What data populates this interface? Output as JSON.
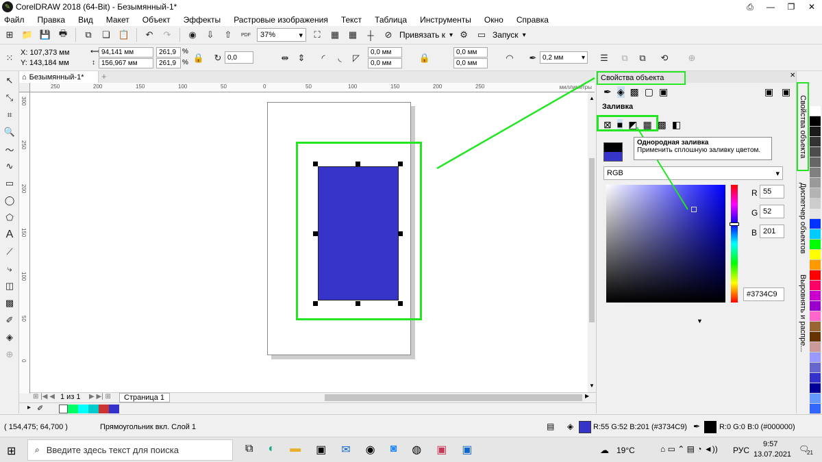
{
  "window": {
    "title": "CorelDRAW 2018 (64-Bit) - Безымянный-1*"
  },
  "menu": [
    "Файл",
    "Правка",
    "Вид",
    "Макет",
    "Объект",
    "Эффекты",
    "Растровые изображения",
    "Текст",
    "Таблица",
    "Инструменты",
    "Окно",
    "Справка"
  ],
  "toolbar": {
    "zoom": "37%",
    "snap_label": "Привязать к",
    "launch_label": "Запуск",
    "pdf_label": "PDF"
  },
  "props": {
    "x": "X: 107,373 мм",
    "y": "Y: 143,184 мм",
    "w": "94,141 мм",
    "h": "156,967 мм",
    "sx": "261,9",
    "sy": "261,9",
    "pct": "%",
    "angle": "0,0",
    "c1": "0,0 мм",
    "c2": "0,0 мм",
    "c3": "0,0 мм",
    "c4": "0,0 мм",
    "outline": "0,2 мм"
  },
  "doc_tab": "Безымянный-1*",
  "ruler_h": [
    "250",
    "200",
    "150",
    "100",
    "50",
    "0",
    "50",
    "100",
    "150",
    "200",
    "250"
  ],
  "ruler_v": [
    "300",
    "250",
    "200",
    "150",
    "100",
    "50",
    "0"
  ],
  "ruler_unit": "миллиметры",
  "pagebar": {
    "counter": "1 из 1",
    "page": "Страница 1"
  },
  "status": {
    "coords": "( 154,475; 64,700 )",
    "object": "Прямоугольник вкл. Слой 1",
    "fill_text": "R:55 G:52 B:201 (#3734C9)",
    "outline_text": "R:0 G:0 B:0 (#000000)"
  },
  "panel": {
    "title": "Свойства объекта",
    "fill_label": "Заливка",
    "tooltip_title": "Однородная заливка",
    "tooltip_text": "Применить сплошную заливку цветом.",
    "model": "RGB",
    "r_label": "R",
    "g_label": "G",
    "b_label": "B",
    "r": "55",
    "g": "52",
    "b": "201",
    "hex": "#3734C9"
  },
  "vtabs": [
    "Свойства объекта",
    "Диспетчер объектов",
    "Выровнять и распре..."
  ],
  "taskbar": {
    "search": "Введите здесь текст для поиска",
    "weather": "19°C",
    "lang": "РУС",
    "time": "9:57",
    "date": "13.07.2021",
    "notif": "21"
  },
  "colors": {
    "fill": "#3734C9",
    "accent_green": "#22e622"
  },
  "palette": [
    "#ffffff",
    "#000000",
    "#1a1a1a",
    "#333333",
    "#4d4d4d",
    "#666666",
    "#808080",
    "#999999",
    "#b3b3b3",
    "#cccccc",
    "#e6e6e6",
    "#0033ff",
    "#00ccff",
    "#00ff00",
    "#ffff00",
    "#ff9900",
    "#ff0000",
    "#ff0066",
    "#cc00cc",
    "#9900cc",
    "#ff66cc",
    "#996633",
    "#663300",
    "#cc9999",
    "#9999ff",
    "#6666cc",
    "#3333cc",
    "#000099",
    "#6699ff",
    "#3366ff"
  ],
  "mini_palette": [
    "#00ff66",
    "#00ffff",
    "#00cccc",
    "#cc3333",
    "#3333cc"
  ]
}
